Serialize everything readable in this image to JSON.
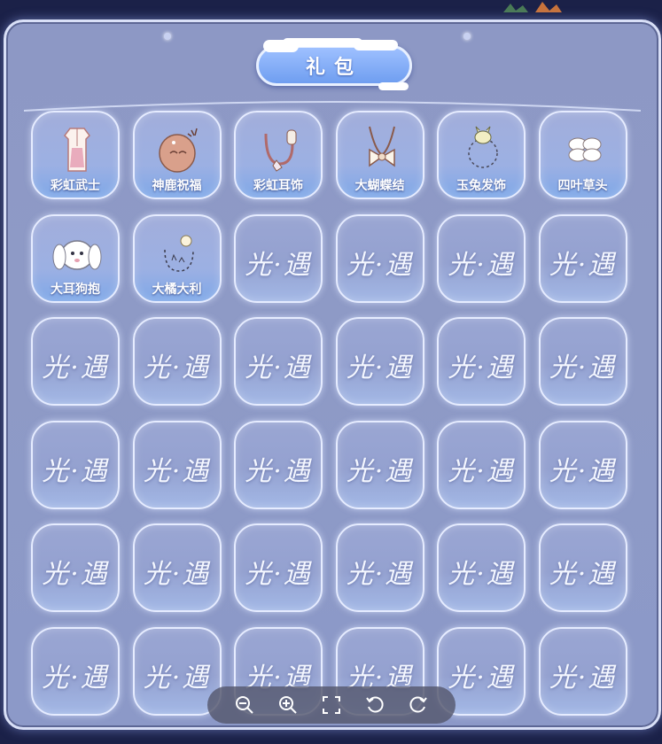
{
  "panel": {
    "title": "礼包"
  },
  "items": [
    {
      "label": "彩虹武士",
      "icon": "robe-icon",
      "filled": true
    },
    {
      "label": "神鹿祝福",
      "icon": "deer-mask-icon",
      "filled": true
    },
    {
      "label": "彩虹耳饰",
      "icon": "earring-icon",
      "filled": true
    },
    {
      "label": "大蝴蝶结",
      "icon": "bow-necklace-icon",
      "filled": true
    },
    {
      "label": "玉兔发饰",
      "icon": "rabbit-hairpin-icon",
      "filled": true
    },
    {
      "label": "四叶草头",
      "icon": "clover-icon",
      "filled": true
    },
    {
      "label": "大耳狗抱",
      "icon": "puppy-icon",
      "filled": true
    },
    {
      "label": "大橘大利",
      "icon": "orange-charm-icon",
      "filled": true
    }
  ],
  "empty_slot": {
    "logo": "光·遇",
    "count": 28
  },
  "toolbar": {
    "buttons": [
      {
        "name": "zoom-out-button",
        "icon": "zoom-out-icon"
      },
      {
        "name": "zoom-in-button",
        "icon": "zoom-in-icon"
      },
      {
        "name": "fullscreen-button",
        "icon": "fullscreen-icon"
      },
      {
        "name": "rotate-left-button",
        "icon": "rotate-left-icon"
      },
      {
        "name": "rotate-right-button",
        "icon": "rotate-right-icon"
      }
    ]
  },
  "colors": {
    "panel": "#8e9ac6",
    "title_pill": "#7fa8f3",
    "toolbar": "#56586e",
    "page_bg": "#1b2148"
  }
}
